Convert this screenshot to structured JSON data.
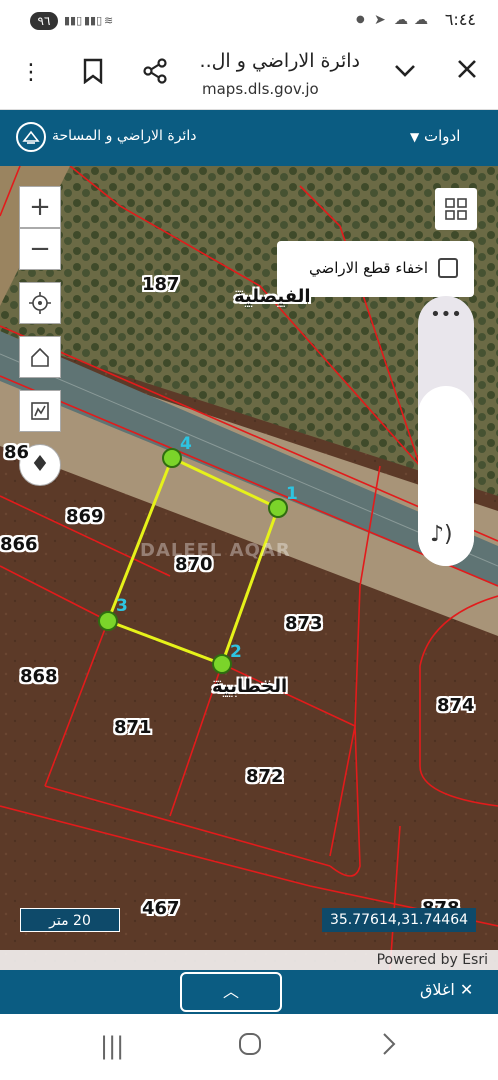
{
  "status_bar": {
    "time": "٦:٤٤",
    "battery_badge": "٩٦",
    "icons": [
      "dot",
      "telegram-icon",
      "weather-icon",
      "cloud-icon",
      "wifi-icon",
      "signal-icon",
      "signal-icon"
    ]
  },
  "browser": {
    "page_title": "دائرة الاراضي و ال..",
    "url": "maps.dls.gov.jo",
    "icons": [
      "close-icon",
      "chevron-down-icon",
      "share-icon",
      "bookmark-icon",
      "more-icon"
    ]
  },
  "app_header": {
    "site_name": "دائرة الاراضي و المساحة",
    "tools_label": "ادوات",
    "accent_color": "#0b5c82"
  },
  "map": {
    "controls": [
      "zoom-in-icon",
      "zoom-out-icon",
      "locate-icon",
      "home-icon",
      "measure-icon",
      "compass-icon"
    ],
    "hide_parcels_label": "اخفاء قطع الاراضي",
    "parcels": [
      "187",
      "869",
      "866",
      "870",
      "873",
      "868",
      "871",
      "872",
      "874",
      "467",
      "878",
      "86"
    ],
    "places": [
      "الفيصلية",
      "الخطابية"
    ],
    "vertices": [
      "1",
      "2",
      "3",
      "4"
    ],
    "watermark": "DALEEL AQAR",
    "scale_label": "20 متر",
    "coordinates": "35.77614,31.74464",
    "attribution": "Powered by Esri"
  },
  "bottom_bar": {
    "close_label": "اغلاق",
    "expand_icon": "chevron-up-icon"
  },
  "nav_bar": {
    "icons": [
      "recent-apps-icon",
      "home-circle-icon",
      "back-icon"
    ]
  }
}
